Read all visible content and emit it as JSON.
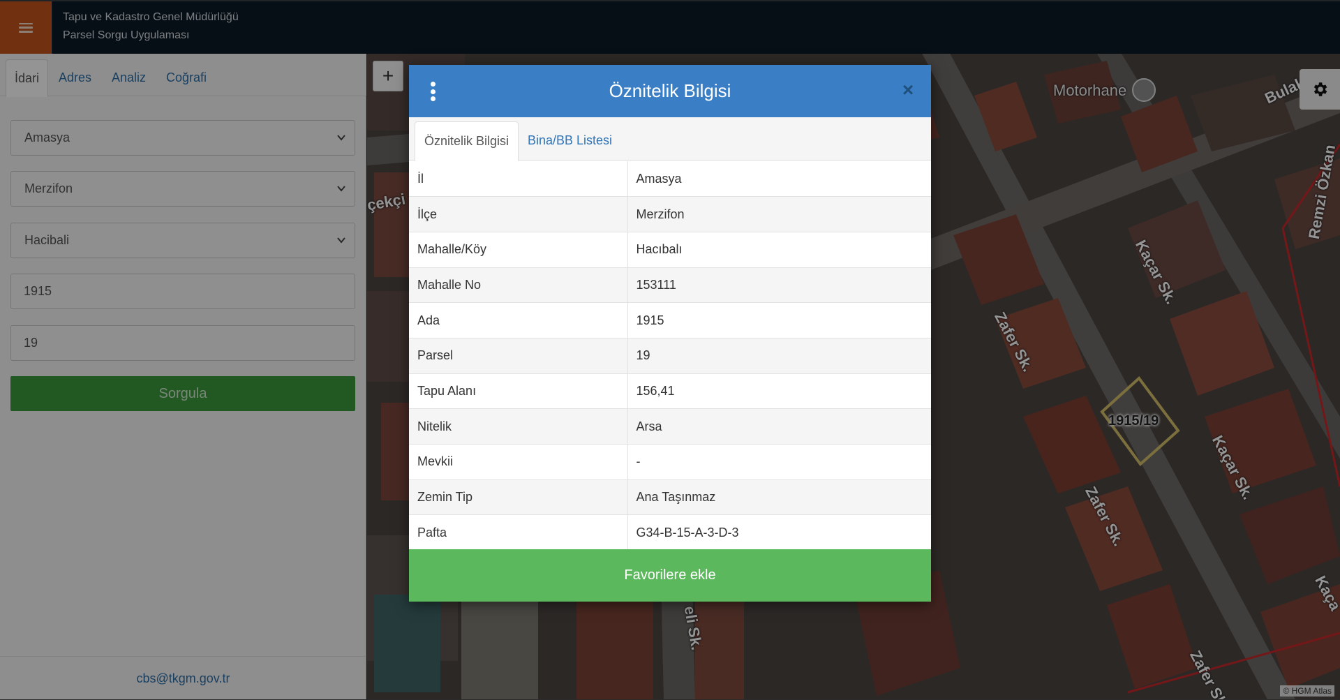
{
  "header": {
    "title_line1": "Tapu ve Kadastro Genel Müdürlüğü",
    "title_line2": "Parsel Sorgu Uygulaması",
    "menu_icon": "hamburger-icon"
  },
  "sidebar": {
    "tabs": [
      {
        "label": "İdari",
        "active": true
      },
      {
        "label": "Adres",
        "active": false
      },
      {
        "label": "Analiz",
        "active": false
      },
      {
        "label": "Coğrafi",
        "active": false
      }
    ],
    "il_value": "Amasya",
    "ilce_value": "Merzifon",
    "mahalle_value": "Hacibali",
    "ada_value": "1915",
    "parsel_value": "19",
    "query_button": "Sorgula",
    "footer_email": "cbs@tkgm.gov.tr"
  },
  "map": {
    "zoom_in_label": "+",
    "streets": [
      "Motorhane",
      "Kaçar Sk.",
      "Zafer Sk.",
      "Kaçar Sk.",
      "Zafer Sk.",
      "Zafer Sk.",
      "Remzi Özkan",
      "Bulak",
      "çekçi",
      "eli Sk.",
      "Kaça"
    ],
    "parcel_label": "1915/19",
    "attribution": "© HGM Atlas",
    "settings_icon": "gear-icon"
  },
  "modal": {
    "title": "Öznitelik Bilgisi",
    "close_label": "×",
    "tabs": [
      {
        "label": "Öznitelik Bilgisi",
        "active": true
      },
      {
        "label": "Bina/BB Listesi",
        "active": false
      }
    ],
    "rows": [
      {
        "key": "İl",
        "value": "Amasya"
      },
      {
        "key": "İlçe",
        "value": "Merzifon"
      },
      {
        "key": "Mahalle/Köy",
        "value": "Hacıbalı"
      },
      {
        "key": "Mahalle No",
        "value": "153111"
      },
      {
        "key": "Ada",
        "value": "1915"
      },
      {
        "key": "Parsel",
        "value": "19"
      },
      {
        "key": "Tapu Alanı",
        "value": "156,41"
      },
      {
        "key": "Nitelik",
        "value": "Arsa"
      },
      {
        "key": "Mevkii",
        "value": "-"
      },
      {
        "key": "Zemin Tip",
        "value": "Ana Taşınmaz"
      },
      {
        "key": "Pafta",
        "value": "G34-B-15-A-3-D-3"
      }
    ],
    "favorite_button": "Favorilere ekle"
  },
  "colors": {
    "header_bg": "#0c1a26",
    "menu_button": "#c3531c",
    "modal_header": "#3a7fc5",
    "favorite_button": "#5cb85c",
    "query_button": "#3c9a3c",
    "link": "#2d6fa8"
  }
}
